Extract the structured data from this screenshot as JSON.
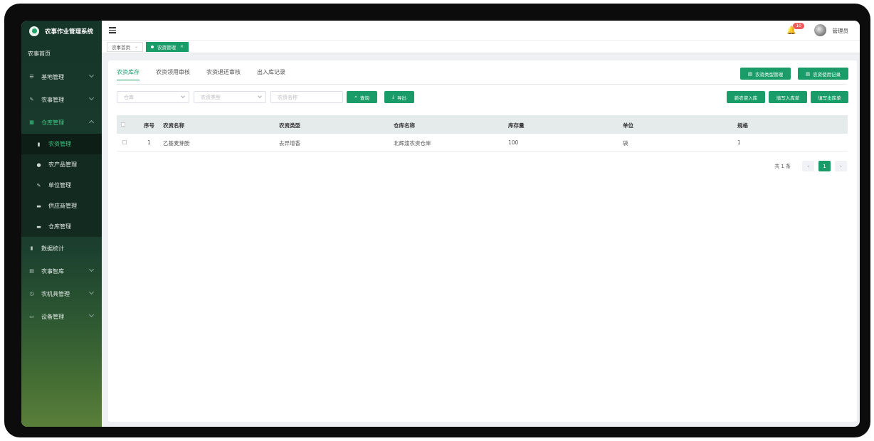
{
  "app": {
    "title": "农事作业管理系统"
  },
  "sidebar": {
    "home": "农事首页",
    "items": [
      {
        "label": "基地管理",
        "icon": "sliders-icon",
        "glyph": "☰",
        "chevron": true
      },
      {
        "label": "农事管理",
        "icon": "edit-icon",
        "glyph": "✎",
        "chevron": true
      },
      {
        "label": "仓库管理",
        "icon": "grid-icon",
        "glyph": "▦",
        "chevron": true,
        "open": true,
        "children": [
          {
            "label": "农资管理",
            "icon": "book-icon",
            "glyph": "▮",
            "active": true
          },
          {
            "label": "农产品管理",
            "icon": "user-icon",
            "glyph": "●"
          },
          {
            "label": "单位管理",
            "icon": "edit-icon",
            "glyph": "✎"
          },
          {
            "label": "供应商管理",
            "icon": "message-icon",
            "glyph": "▬"
          },
          {
            "label": "仓库管理",
            "icon": "message-icon",
            "glyph": "▬"
          }
        ]
      },
      {
        "label": "数据统计",
        "icon": "bar-chart-icon",
        "glyph": "▮",
        "chevron": false
      },
      {
        "label": "农事智库",
        "icon": "document-icon",
        "glyph": "▤",
        "chevron": true
      },
      {
        "label": "农机具管理",
        "icon": "clock-icon",
        "glyph": "◷",
        "chevron": true
      },
      {
        "label": "设备管理",
        "icon": "briefcase-icon",
        "glyph": "▭",
        "chevron": true
      }
    ]
  },
  "header": {
    "notification_count": "10",
    "username": "管理员"
  },
  "tags": [
    {
      "label": "农事首页",
      "close": "⌄"
    },
    {
      "label": "农资管理",
      "close": "×"
    }
  ],
  "page_tabs": [
    "农资库存",
    "农资领用审核",
    "农资退还审核",
    "出入库记录"
  ],
  "top_buttons": {
    "type_manage": "农资类型管理",
    "usage_record": "农资使用记录"
  },
  "filters": {
    "warehouse_placeholder": "仓库",
    "type_placeholder": "农资类型",
    "name_placeholder": "农资名称",
    "search": "查询",
    "export": "导出"
  },
  "action_buttons": {
    "new_in": "新农资入库",
    "fill_in": "填写入库单",
    "fill_out": "填写出库单"
  },
  "table": {
    "columns": [
      "序号",
      "农资名称",
      "农资类型",
      "仓库名称",
      "库存量",
      "单位",
      "规格"
    ],
    "rows": [
      [
        "1",
        "乙基麦芽酚",
        "去异增香",
        "北辉渡农资仓库",
        "100",
        "袋",
        "1"
      ]
    ]
  },
  "pagination": {
    "total": "共 1 条",
    "prev": "‹",
    "page": "1",
    "next": "›"
  }
}
